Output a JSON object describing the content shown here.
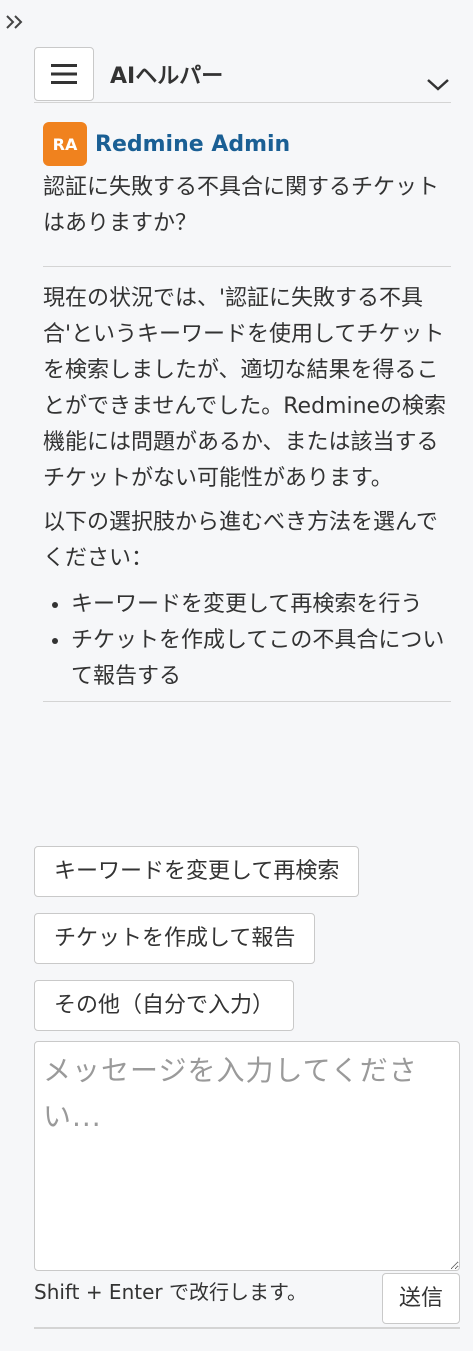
{
  "panel": {
    "title": "AIヘルパー"
  },
  "user": {
    "initials": "RA",
    "name": "Redmine Admin",
    "avatar_color": "#f0821e",
    "name_color": "#1a5f94"
  },
  "question": "認証に失敗する不具合に関するチケットはありますか？",
  "answer": {
    "paragraph1": "現在の状況では、'認証に失敗する不具合'というキーワードを使用してチケットを検索しましたが、適切な結果を得ることができませんでした。Redmineの検索機能には問題があるか、または該当するチケットがない可能性があります。",
    "paragraph2": "以下の選択肢から進むべき方法を選んでください：",
    "options": [
      "キーワードを変更して再検索を行う",
      "チケットを作成してこの不具合について報告する"
    ]
  },
  "choices": [
    "キーワードを変更して再検索",
    "チケットを作成して報告",
    "その他（自分で入力）"
  ],
  "input": {
    "placeholder": "メッセージを入力してください..."
  },
  "hint": "Shift + Enter で改行します。",
  "send_label": "送信",
  "icons": {
    "collapse": "double-chevron-right-icon",
    "menu": "hamburger-icon",
    "expand": "chevron-down-icon"
  }
}
